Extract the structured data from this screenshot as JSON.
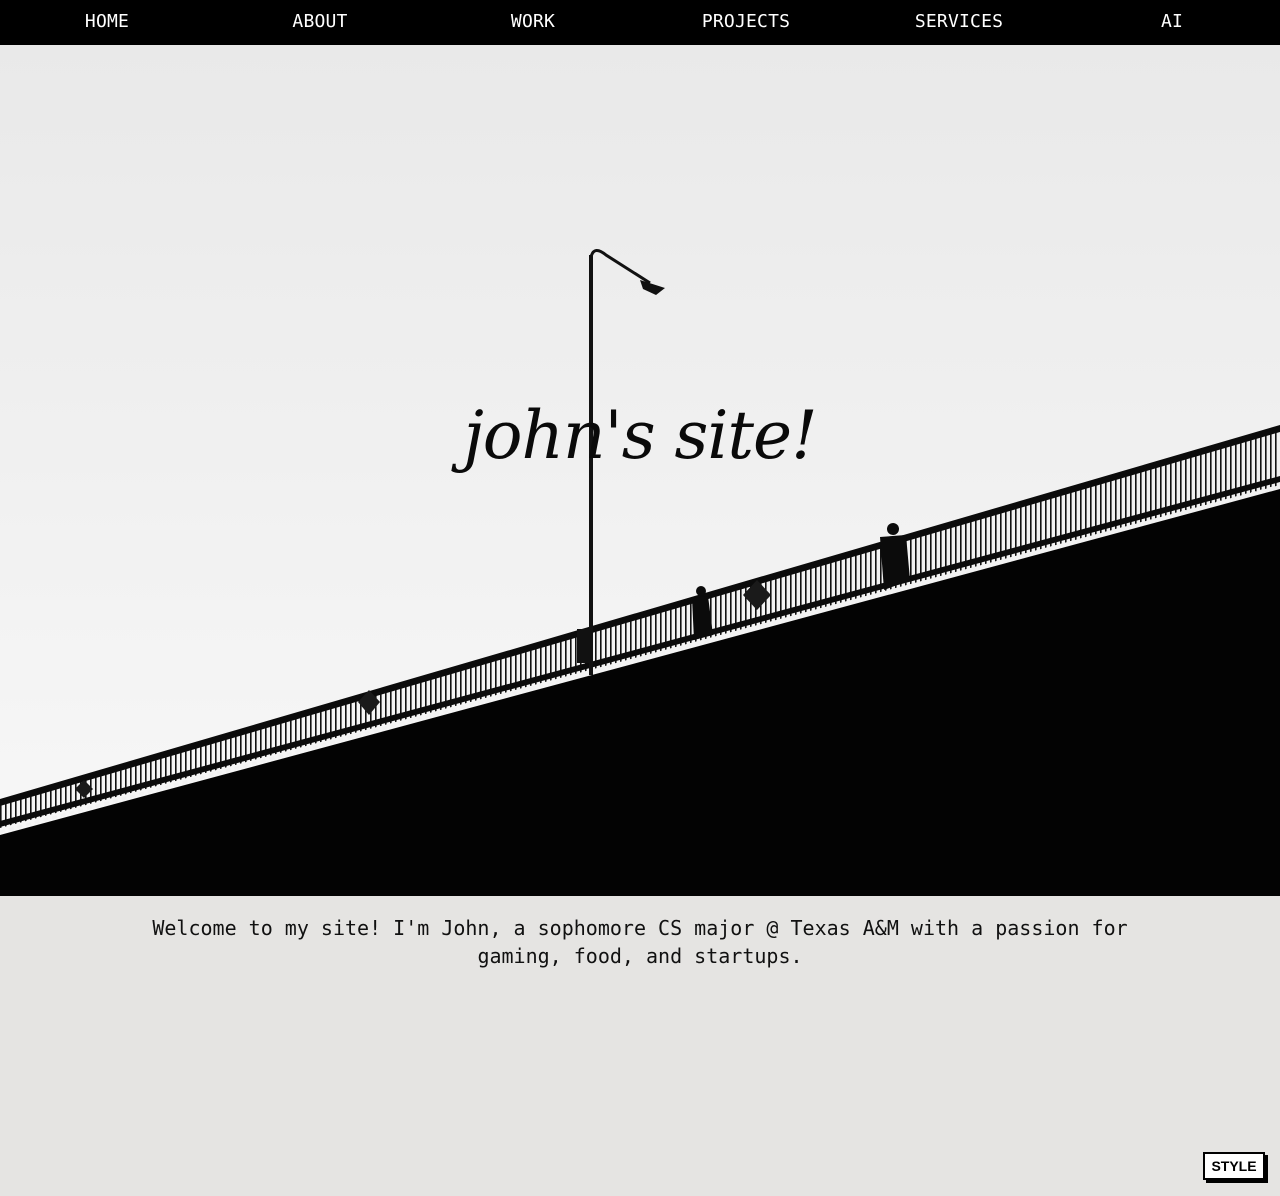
{
  "nav": {
    "items": [
      {
        "label": "HOME"
      },
      {
        "label": "ABOUT"
      },
      {
        "label": "WORK"
      },
      {
        "label": "PROJECTS"
      },
      {
        "label": "SERVICES"
      },
      {
        "label": "AI"
      }
    ]
  },
  "hero": {
    "title": "john's site!"
  },
  "intro": {
    "text": "Welcome to my site! I'm John, a sophomore CS major @ Texas A&M with a passion for gaming, food, and startups."
  },
  "style_button": {
    "label": "STYLE"
  },
  "colors": {
    "nav_background": "#000000",
    "nav_text": "#ffffff",
    "page_background": "#e5e4e2",
    "text": "#111111"
  }
}
